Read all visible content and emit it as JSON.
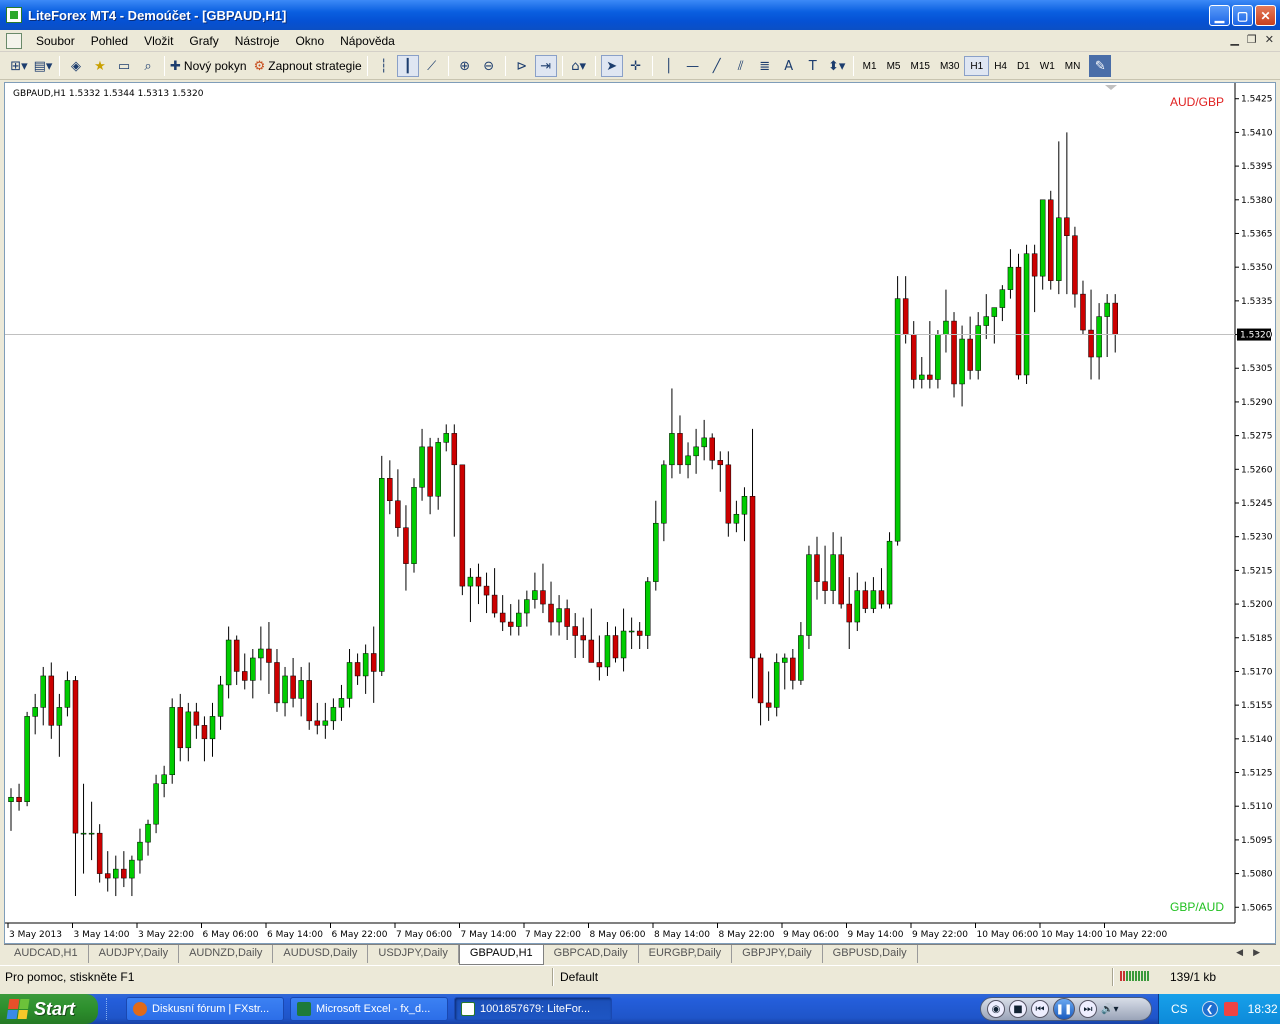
{
  "window": {
    "title": "LiteForex MT4 - Demoúčet - [GBPAUD,H1]"
  },
  "menu": {
    "items": [
      "Soubor",
      "Pohled",
      "Vložit",
      "Grafy",
      "Nástroje",
      "Okno",
      "Nápověda"
    ]
  },
  "toolbar": {
    "new_order": "Nový pokyn",
    "strategies": "Zapnout strategie",
    "timeframes": [
      "M1",
      "M5",
      "M15",
      "M30",
      "H1",
      "H4",
      "D1",
      "W1",
      "MN"
    ],
    "active_timeframe": "H1"
  },
  "chart": {
    "header": "GBPAUD,H1  1.5332 1.5344 1.5313 1.5320",
    "label_top": "AUD/GBP",
    "label_bottom": "GBP/AUD",
    "label_top_color": "#e02020",
    "label_bottom_color": "#20c020",
    "bull_color": "#00cc00",
    "bear_color": "#cc0000",
    "current_price": "1.5320",
    "y_ticks": [
      "1.5425",
      "1.5410",
      "1.5395",
      "1.5380",
      "1.5365",
      "1.5350",
      "1.5335",
      "1.5320",
      "1.5305",
      "1.5290",
      "1.5275",
      "1.5260",
      "1.5245",
      "1.5230",
      "1.5215",
      "1.5200",
      "1.5185",
      "1.5170",
      "1.5155",
      "1.5140",
      "1.5125",
      "1.5110",
      "1.5095",
      "1.5080",
      "1.5065"
    ],
    "x_ticks": [
      "3 May 2013",
      "3 May 14:00",
      "3 May 22:00",
      "6 May 06:00",
      "6 May 14:00",
      "6 May 22:00",
      "7 May 06:00",
      "7 May 14:00",
      "7 May 22:00",
      "8 May 06:00",
      "8 May 14:00",
      "8 May 22:00",
      "9 May 06:00",
      "9 May 14:00",
      "9 May 22:00",
      "10 May 06:00",
      "10 May 14:00",
      "10 May 22:00"
    ]
  },
  "chart_data": {
    "type": "candlestick",
    "symbol": "GBPAUD",
    "timeframe": "H1",
    "ylim": [
      1.5058,
      1.5432
    ],
    "grid": false,
    "candles": [
      [
        1.5112,
        1.5118,
        1.5099,
        1.5114
      ],
      [
        1.5114,
        1.512,
        1.5108,
        1.5112
      ],
      [
        1.5112,
        1.5152,
        1.511,
        1.515
      ],
      [
        1.515,
        1.516,
        1.5142,
        1.5154
      ],
      [
        1.5154,
        1.5172,
        1.5146,
        1.5168
      ],
      [
        1.5168,
        1.5174,
        1.514,
        1.5146
      ],
      [
        1.5146,
        1.516,
        1.5132,
        1.5154
      ],
      [
        1.5154,
        1.517,
        1.515,
        1.5166
      ],
      [
        1.5166,
        1.5168,
        1.507,
        1.5098
      ],
      [
        1.5098,
        1.512,
        1.508,
        1.5098
      ],
      [
        1.5098,
        1.5112,
        1.5086,
        1.5098
      ],
      [
        1.5098,
        1.5102,
        1.5076,
        1.508
      ],
      [
        1.508,
        1.509,
        1.5072,
        1.5078
      ],
      [
        1.5078,
        1.5088,
        1.507,
        1.5082
      ],
      [
        1.5082,
        1.509,
        1.5074,
        1.5078
      ],
      [
        1.5078,
        1.5088,
        1.507,
        1.5086
      ],
      [
        1.5086,
        1.51,
        1.508,
        1.5094
      ],
      [
        1.5094,
        1.5104,
        1.5088,
        1.5102
      ],
      [
        1.5102,
        1.5124,
        1.5098,
        1.512
      ],
      [
        1.512,
        1.5128,
        1.5114,
        1.5124
      ],
      [
        1.5124,
        1.5158,
        1.512,
        1.5154
      ],
      [
        1.5154,
        1.516,
        1.513,
        1.5136
      ],
      [
        1.5136,
        1.5156,
        1.513,
        1.5152
      ],
      [
        1.5152,
        1.5156,
        1.514,
        1.5146
      ],
      [
        1.5146,
        1.515,
        1.513,
        1.514
      ],
      [
        1.514,
        1.5156,
        1.5132,
        1.515
      ],
      [
        1.515,
        1.5168,
        1.5144,
        1.5164
      ],
      [
        1.5164,
        1.519,
        1.5158,
        1.5184
      ],
      [
        1.5184,
        1.5186,
        1.5164,
        1.517
      ],
      [
        1.517,
        1.5178,
        1.5162,
        1.5166
      ],
      [
        1.5166,
        1.518,
        1.5158,
        1.5176
      ],
      [
        1.5176,
        1.519,
        1.5166,
        1.518
      ],
      [
        1.518,
        1.5192,
        1.516,
        1.5174
      ],
      [
        1.5174,
        1.518,
        1.5152,
        1.5156
      ],
      [
        1.5156,
        1.5172,
        1.515,
        1.5168
      ],
      [
        1.5168,
        1.5176,
        1.5154,
        1.5158
      ],
      [
        1.5158,
        1.5172,
        1.515,
        1.5166
      ],
      [
        1.5166,
        1.5174,
        1.5144,
        1.5148
      ],
      [
        1.5148,
        1.5156,
        1.5142,
        1.5146
      ],
      [
        1.5146,
        1.5156,
        1.514,
        1.5148
      ],
      [
        1.5148,
        1.5158,
        1.5144,
        1.5154
      ],
      [
        1.5154,
        1.5164,
        1.5148,
        1.5158
      ],
      [
        1.5158,
        1.518,
        1.5154,
        1.5174
      ],
      [
        1.5174,
        1.5178,
        1.5164,
        1.5168
      ],
      [
        1.5168,
        1.5182,
        1.516,
        1.5178
      ],
      [
        1.5178,
        1.519,
        1.5156,
        1.517
      ],
      [
        1.517,
        1.5266,
        1.5168,
        1.5256
      ],
      [
        1.5256,
        1.5264,
        1.524,
        1.5246
      ],
      [
        1.5246,
        1.526,
        1.523,
        1.5234
      ],
      [
        1.5234,
        1.5244,
        1.5206,
        1.5218
      ],
      [
        1.5218,
        1.5256,
        1.5214,
        1.5252
      ],
      [
        1.5252,
        1.5278,
        1.5246,
        1.527
      ],
      [
        1.527,
        1.5274,
        1.524,
        1.5248
      ],
      [
        1.5248,
        1.5274,
        1.5242,
        1.5272
      ],
      [
        1.5272,
        1.528,
        1.5268,
        1.5276
      ],
      [
        1.5276,
        1.528,
        1.523,
        1.5262
      ],
      [
        1.5262,
        1.5262,
        1.5204,
        1.5208
      ],
      [
        1.5208,
        1.5216,
        1.5192,
        1.5212
      ],
      [
        1.5212,
        1.5218,
        1.52,
        1.5208
      ],
      [
        1.5208,
        1.5214,
        1.5196,
        1.5204
      ],
      [
        1.5204,
        1.5216,
        1.5194,
        1.5196
      ],
      [
        1.5196,
        1.5204,
        1.5188,
        1.5192
      ],
      [
        1.5192,
        1.52,
        1.5186,
        1.519
      ],
      [
        1.519,
        1.5202,
        1.5186,
        1.5196
      ],
      [
        1.5196,
        1.5206,
        1.519,
        1.5202
      ],
      [
        1.5202,
        1.5214,
        1.5198,
        1.5206
      ],
      [
        1.5206,
        1.5218,
        1.5196,
        1.52
      ],
      [
        1.52,
        1.521,
        1.5186,
        1.5192
      ],
      [
        1.5192,
        1.5204,
        1.5186,
        1.5198
      ],
      [
        1.5198,
        1.5202,
        1.5184,
        1.519
      ],
      [
        1.519,
        1.5196,
        1.5176,
        1.5186
      ],
      [
        1.5186,
        1.5194,
        1.5176,
        1.5184
      ],
      [
        1.5184,
        1.5198,
        1.5174,
        1.5174
      ],
      [
        1.5174,
        1.5186,
        1.5166,
        1.5172
      ],
      [
        1.5172,
        1.5192,
        1.5168,
        1.5186
      ],
      [
        1.5186,
        1.519,
        1.5174,
        1.5176
      ],
      [
        1.5176,
        1.5198,
        1.517,
        1.5188
      ],
      [
        1.5188,
        1.5194,
        1.518,
        1.5188
      ],
      [
        1.5188,
        1.5192,
        1.518,
        1.5186
      ],
      [
        1.5186,
        1.5212,
        1.518,
        1.521
      ],
      [
        1.521,
        1.5246,
        1.5206,
        1.5236
      ],
      [
        1.5236,
        1.5264,
        1.5228,
        1.5262
      ],
      [
        1.5262,
        1.5296,
        1.5256,
        1.5276
      ],
      [
        1.5276,
        1.5284,
        1.5258,
        1.5262
      ],
      [
        1.5262,
        1.5272,
        1.5256,
        1.5266
      ],
      [
        1.5266,
        1.5278,
        1.5258,
        1.527
      ],
      [
        1.527,
        1.5282,
        1.5264,
        1.5274
      ],
      [
        1.5274,
        1.5276,
        1.526,
        1.5264
      ],
      [
        1.5264,
        1.5268,
        1.525,
        1.5262
      ],
      [
        1.5262,
        1.5268,
        1.523,
        1.5236
      ],
      [
        1.5236,
        1.5246,
        1.5232,
        1.524
      ],
      [
        1.524,
        1.5252,
        1.5228,
        1.5248
      ],
      [
        1.5248,
        1.5278,
        1.5158,
        1.5176
      ],
      [
        1.5176,
        1.5178,
        1.5146,
        1.5156
      ],
      [
        1.5156,
        1.517,
        1.5148,
        1.5154
      ],
      [
        1.5154,
        1.5178,
        1.515,
        1.5174
      ],
      [
        1.5174,
        1.5178,
        1.5162,
        1.5176
      ],
      [
        1.5176,
        1.518,
        1.5162,
        1.5166
      ],
      [
        1.5166,
        1.5192,
        1.5164,
        1.5186
      ],
      [
        1.5186,
        1.5226,
        1.518,
        1.5222
      ],
      [
        1.5222,
        1.523,
        1.5202,
        1.521
      ],
      [
        1.521,
        1.5226,
        1.52,
        1.5206
      ],
      [
        1.5206,
        1.5232,
        1.52,
        1.5222
      ],
      [
        1.5222,
        1.523,
        1.5198,
        1.52
      ],
      [
        1.52,
        1.5212,
        1.518,
        1.5192
      ],
      [
        1.5192,
        1.5214,
        1.5188,
        1.5206
      ],
      [
        1.5206,
        1.521,
        1.5196,
        1.5198
      ],
      [
        1.5198,
        1.5212,
        1.5196,
        1.5206
      ],
      [
        1.5206,
        1.5216,
        1.5198,
        1.52
      ],
      [
        1.52,
        1.5232,
        1.5198,
        1.5228
      ],
      [
        1.5228,
        1.5346,
        1.5226,
        1.5336
      ],
      [
        1.5336,
        1.5346,
        1.5316,
        1.532
      ],
      [
        1.532,
        1.5326,
        1.5296,
        1.53
      ],
      [
        1.53,
        1.531,
        1.5296,
        1.5302
      ],
      [
        1.5302,
        1.5326,
        1.5296,
        1.53
      ],
      [
        1.53,
        1.5322,
        1.5296,
        1.532
      ],
      [
        1.532,
        1.534,
        1.5312,
        1.5326
      ],
      [
        1.5326,
        1.533,
        1.5292,
        1.5298
      ],
      [
        1.5298,
        1.5324,
        1.5288,
        1.5318
      ],
      [
        1.5318,
        1.5328,
        1.53,
        1.5304
      ],
      [
        1.5304,
        1.533,
        1.53,
        1.5324
      ],
      [
        1.5324,
        1.5338,
        1.5318,
        1.5328
      ],
      [
        1.5328,
        1.5332,
        1.5316,
        1.5332
      ],
      [
        1.5332,
        1.5342,
        1.5326,
        1.534
      ],
      [
        1.534,
        1.5358,
        1.5336,
        1.535
      ],
      [
        1.535,
        1.5356,
        1.53,
        1.5302
      ],
      [
        1.5302,
        1.536,
        1.5298,
        1.5356
      ],
      [
        1.5356,
        1.536,
        1.533,
        1.5346
      ],
      [
        1.5346,
        1.5372,
        1.534,
        1.538
      ],
      [
        1.538,
        1.5384,
        1.534,
        1.5344
      ],
      [
        1.5344,
        1.5406,
        1.5338,
        1.5372
      ],
      [
        1.5372,
        1.541,
        1.5338,
        1.5364
      ],
      [
        1.5364,
        1.5368,
        1.5332,
        1.5338
      ],
      [
        1.5338,
        1.5344,
        1.532,
        1.5322
      ],
      [
        1.5322,
        1.534,
        1.53,
        1.531
      ],
      [
        1.531,
        1.5334,
        1.53,
        1.5328
      ],
      [
        1.5328,
        1.5338,
        1.531,
        1.5334
      ],
      [
        1.5334,
        1.5338,
        1.5312,
        1.532
      ]
    ]
  },
  "tabs": {
    "items": [
      "AUDCAD,H1",
      "AUDJPY,Daily",
      "AUDNZD,Daily",
      "AUDUSD,Daily",
      "USDJPY,Daily",
      "GBPAUD,H1",
      "GBPCAD,Daily",
      "EURGBP,Daily",
      "GBPJPY,Daily",
      "GBPUSD,Daily"
    ],
    "active": "GBPAUD,H1"
  },
  "status": {
    "help": "Pro pomoc, stiskněte F1",
    "profile": "Default",
    "traffic": "139/1 kb"
  },
  "taskbar": {
    "start": "Start",
    "tasks": [
      "Diskusní fórum | FXstr...",
      "Microsoft Excel - fx_d...",
      "1001857679: LiteFor..."
    ],
    "lang": "CS",
    "time": "18:32"
  }
}
